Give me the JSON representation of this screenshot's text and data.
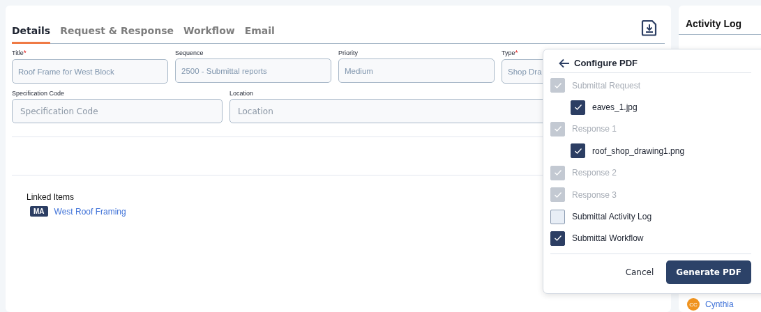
{
  "tabs": [
    {
      "label": "Details",
      "selected": true
    },
    {
      "label": "Request & Response",
      "selected": false
    },
    {
      "label": "Workflow",
      "selected": false
    },
    {
      "label": "Email",
      "selected": false
    }
  ],
  "fields_row_1": [
    {
      "label": "Title",
      "required_mark": "*",
      "value": "Roof Frame for West Block"
    },
    {
      "label": "Sequence",
      "value": "2500 - Submittal reports"
    },
    {
      "label": "Priority",
      "value": "Medium"
    },
    {
      "label": "Type",
      "required_mark": "*",
      "value": "Shop Dra"
    }
  ],
  "fields_row_2": [
    {
      "label": "Specification Code",
      "placeholder": "Specification Code"
    },
    {
      "label": "Location",
      "placeholder": "Location"
    }
  ],
  "linked_items": {
    "title": "Linked Items",
    "items": [
      {
        "badge": "MA",
        "label": "West Roof Framing"
      }
    ]
  },
  "activity_log": {
    "title": "Activity Log",
    "entries": [
      {
        "initials": "CC",
        "name": "Cynthia"
      }
    ]
  },
  "configure_pdf": {
    "title": "Configure PDF",
    "items": [
      {
        "label": "Submittal Request",
        "checked": true,
        "disabled": true,
        "children": [
          {
            "label": "eaves_1.jpg",
            "checked": true,
            "disabled": false
          }
        ]
      },
      {
        "label": "Response 1",
        "checked": true,
        "disabled": true,
        "children": [
          {
            "label": "roof_shop_drawing1.png",
            "checked": true,
            "disabled": false
          }
        ]
      },
      {
        "label": "Response 2",
        "checked": true,
        "disabled": true
      },
      {
        "label": "Response 3",
        "checked": true,
        "disabled": true
      },
      {
        "label": "Submittal Activity Log",
        "checked": false,
        "disabled": false
      },
      {
        "label": "Submittal Workflow",
        "checked": true,
        "disabled": false
      }
    ],
    "buttons": [
      {
        "label": "Cancel",
        "kind": "text"
      },
      {
        "label": "Generate PDF",
        "kind": "primary"
      }
    ]
  }
}
